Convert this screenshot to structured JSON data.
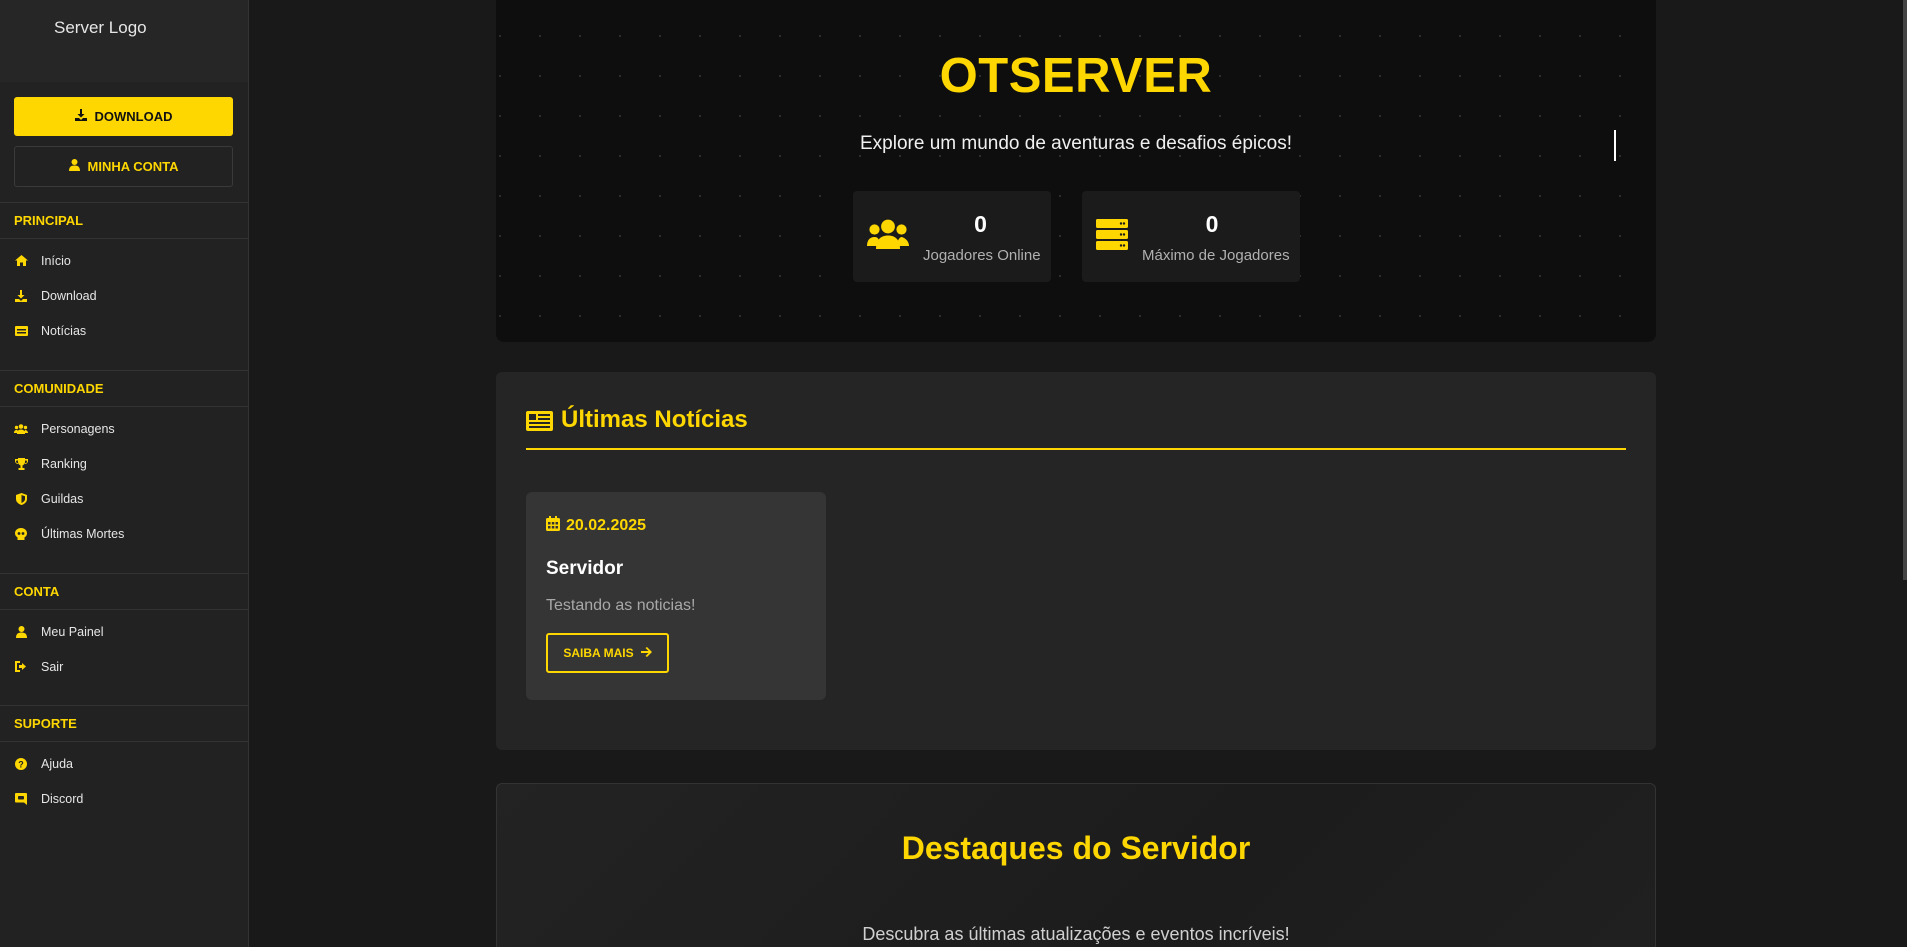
{
  "sidebar": {
    "logo_alt": "Server Logo",
    "download_button": "DOWNLOAD",
    "account_button": "MINHA CONTA",
    "sections": [
      {
        "title": "PRINCIPAL",
        "items": [
          {
            "label": "Início",
            "icon": "home-icon"
          },
          {
            "label": "Download",
            "icon": "download-icon"
          },
          {
            "label": "Notícias",
            "icon": "newspaper-icon"
          }
        ]
      },
      {
        "title": "COMUNIDADE",
        "items": [
          {
            "label": "Personagens",
            "icon": "users-icon"
          },
          {
            "label": "Ranking",
            "icon": "trophy-icon"
          },
          {
            "label": "Guildas",
            "icon": "shield-icon"
          },
          {
            "label": "Últimas Mortes",
            "icon": "skull-icon"
          }
        ]
      },
      {
        "title": "CONTA",
        "items": [
          {
            "label": "Meu Painel",
            "icon": "user-icon"
          },
          {
            "label": "Sair",
            "icon": "sign-out-icon"
          }
        ]
      },
      {
        "title": "SUPORTE",
        "items": [
          {
            "label": "Ajuda",
            "icon": "question-icon"
          },
          {
            "label": "Discord",
            "icon": "discord-icon"
          }
        ]
      }
    ]
  },
  "hero": {
    "title": "OTSERVER",
    "subtitle": "Explore um mundo de aventuras e desafios épicos!",
    "stats": [
      {
        "value": "0",
        "label": "Jogadores Online",
        "icon": "users-icon"
      },
      {
        "value": "0",
        "label": "Máximo de Jogadores",
        "icon": "server-icon"
      }
    ]
  },
  "news": {
    "heading": "Últimas Notícias",
    "items": [
      {
        "date": "20.02.2025",
        "title": "Servidor",
        "text": "Testando as noticias!",
        "button": "SAIBA MAIS"
      }
    ]
  },
  "featured": {
    "title": "Destaques do Servidor",
    "subtitle": "Descubra as últimas atualizações e eventos incríveis!"
  },
  "colors": {
    "accent": "#ffd700",
    "background": "#191919",
    "sidebar": "#222222",
    "card": "#353535"
  }
}
